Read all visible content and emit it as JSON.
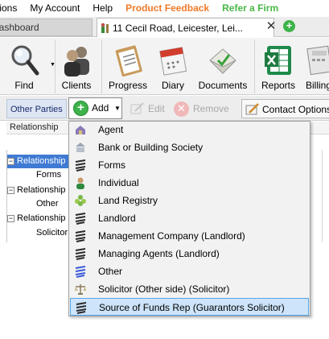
{
  "menu": {
    "items": [
      {
        "label": "tions"
      },
      {
        "label": "My Account"
      },
      {
        "label": "Help"
      },
      {
        "label": "Product Feedback"
      },
      {
        "label": "Refer a Firm"
      }
    ]
  },
  "tabs": {
    "dashboard": "Dashboard",
    "active": "11 Cecil Road, Leicester, Lei...",
    "close_glyph": "✕",
    "add_glyph": "+"
  },
  "ribbon": {
    "find": "Find",
    "clients": "Clients",
    "progress": "Progress",
    "diary": "Diary",
    "documents": "Documents",
    "reports": "Reports",
    "billing": "Billing"
  },
  "toolbar": {
    "title": "Other Parties",
    "add": "Add",
    "edit": "Edit",
    "remove": "Remove",
    "contact_options": "Contact Options"
  },
  "grid": {
    "column": "Relationship",
    "rows": [
      {
        "label": "Relationship",
        "child": "Forms"
      },
      {
        "label": "Relationship",
        "child": "Other"
      },
      {
        "label": "Relationship",
        "child": "Solicitor"
      }
    ]
  },
  "dropdown": {
    "items": [
      {
        "label": "Agent",
        "icon": "agent-icon"
      },
      {
        "label": "Bank or Building Society",
        "icon": "bank-icon"
      },
      {
        "label": "Forms",
        "icon": "forms-icon"
      },
      {
        "label": "Individual",
        "icon": "individual-icon"
      },
      {
        "label": "Land Registry",
        "icon": "land-registry-icon"
      },
      {
        "label": "Landlord",
        "icon": "landlord-icon"
      },
      {
        "label": "Management Company (Landlord)",
        "icon": "management-company-icon"
      },
      {
        "label": "Managing Agents (Landlord)",
        "icon": "managing-agents-icon"
      },
      {
        "label": "Other",
        "icon": "other-icon"
      },
      {
        "label": "Solicitor (Other side) (Solicitor)",
        "icon": "solicitor-icon"
      },
      {
        "label": "Source of Funds Rep (Guarantors Solicitor)",
        "icon": "source-of-funds-icon"
      }
    ],
    "highlighted_index": 10
  },
  "colors": {
    "feedback": "#f07a2a",
    "refer": "#48b848",
    "highlight": "#cde4fa",
    "selection": "#3f7bd3"
  }
}
